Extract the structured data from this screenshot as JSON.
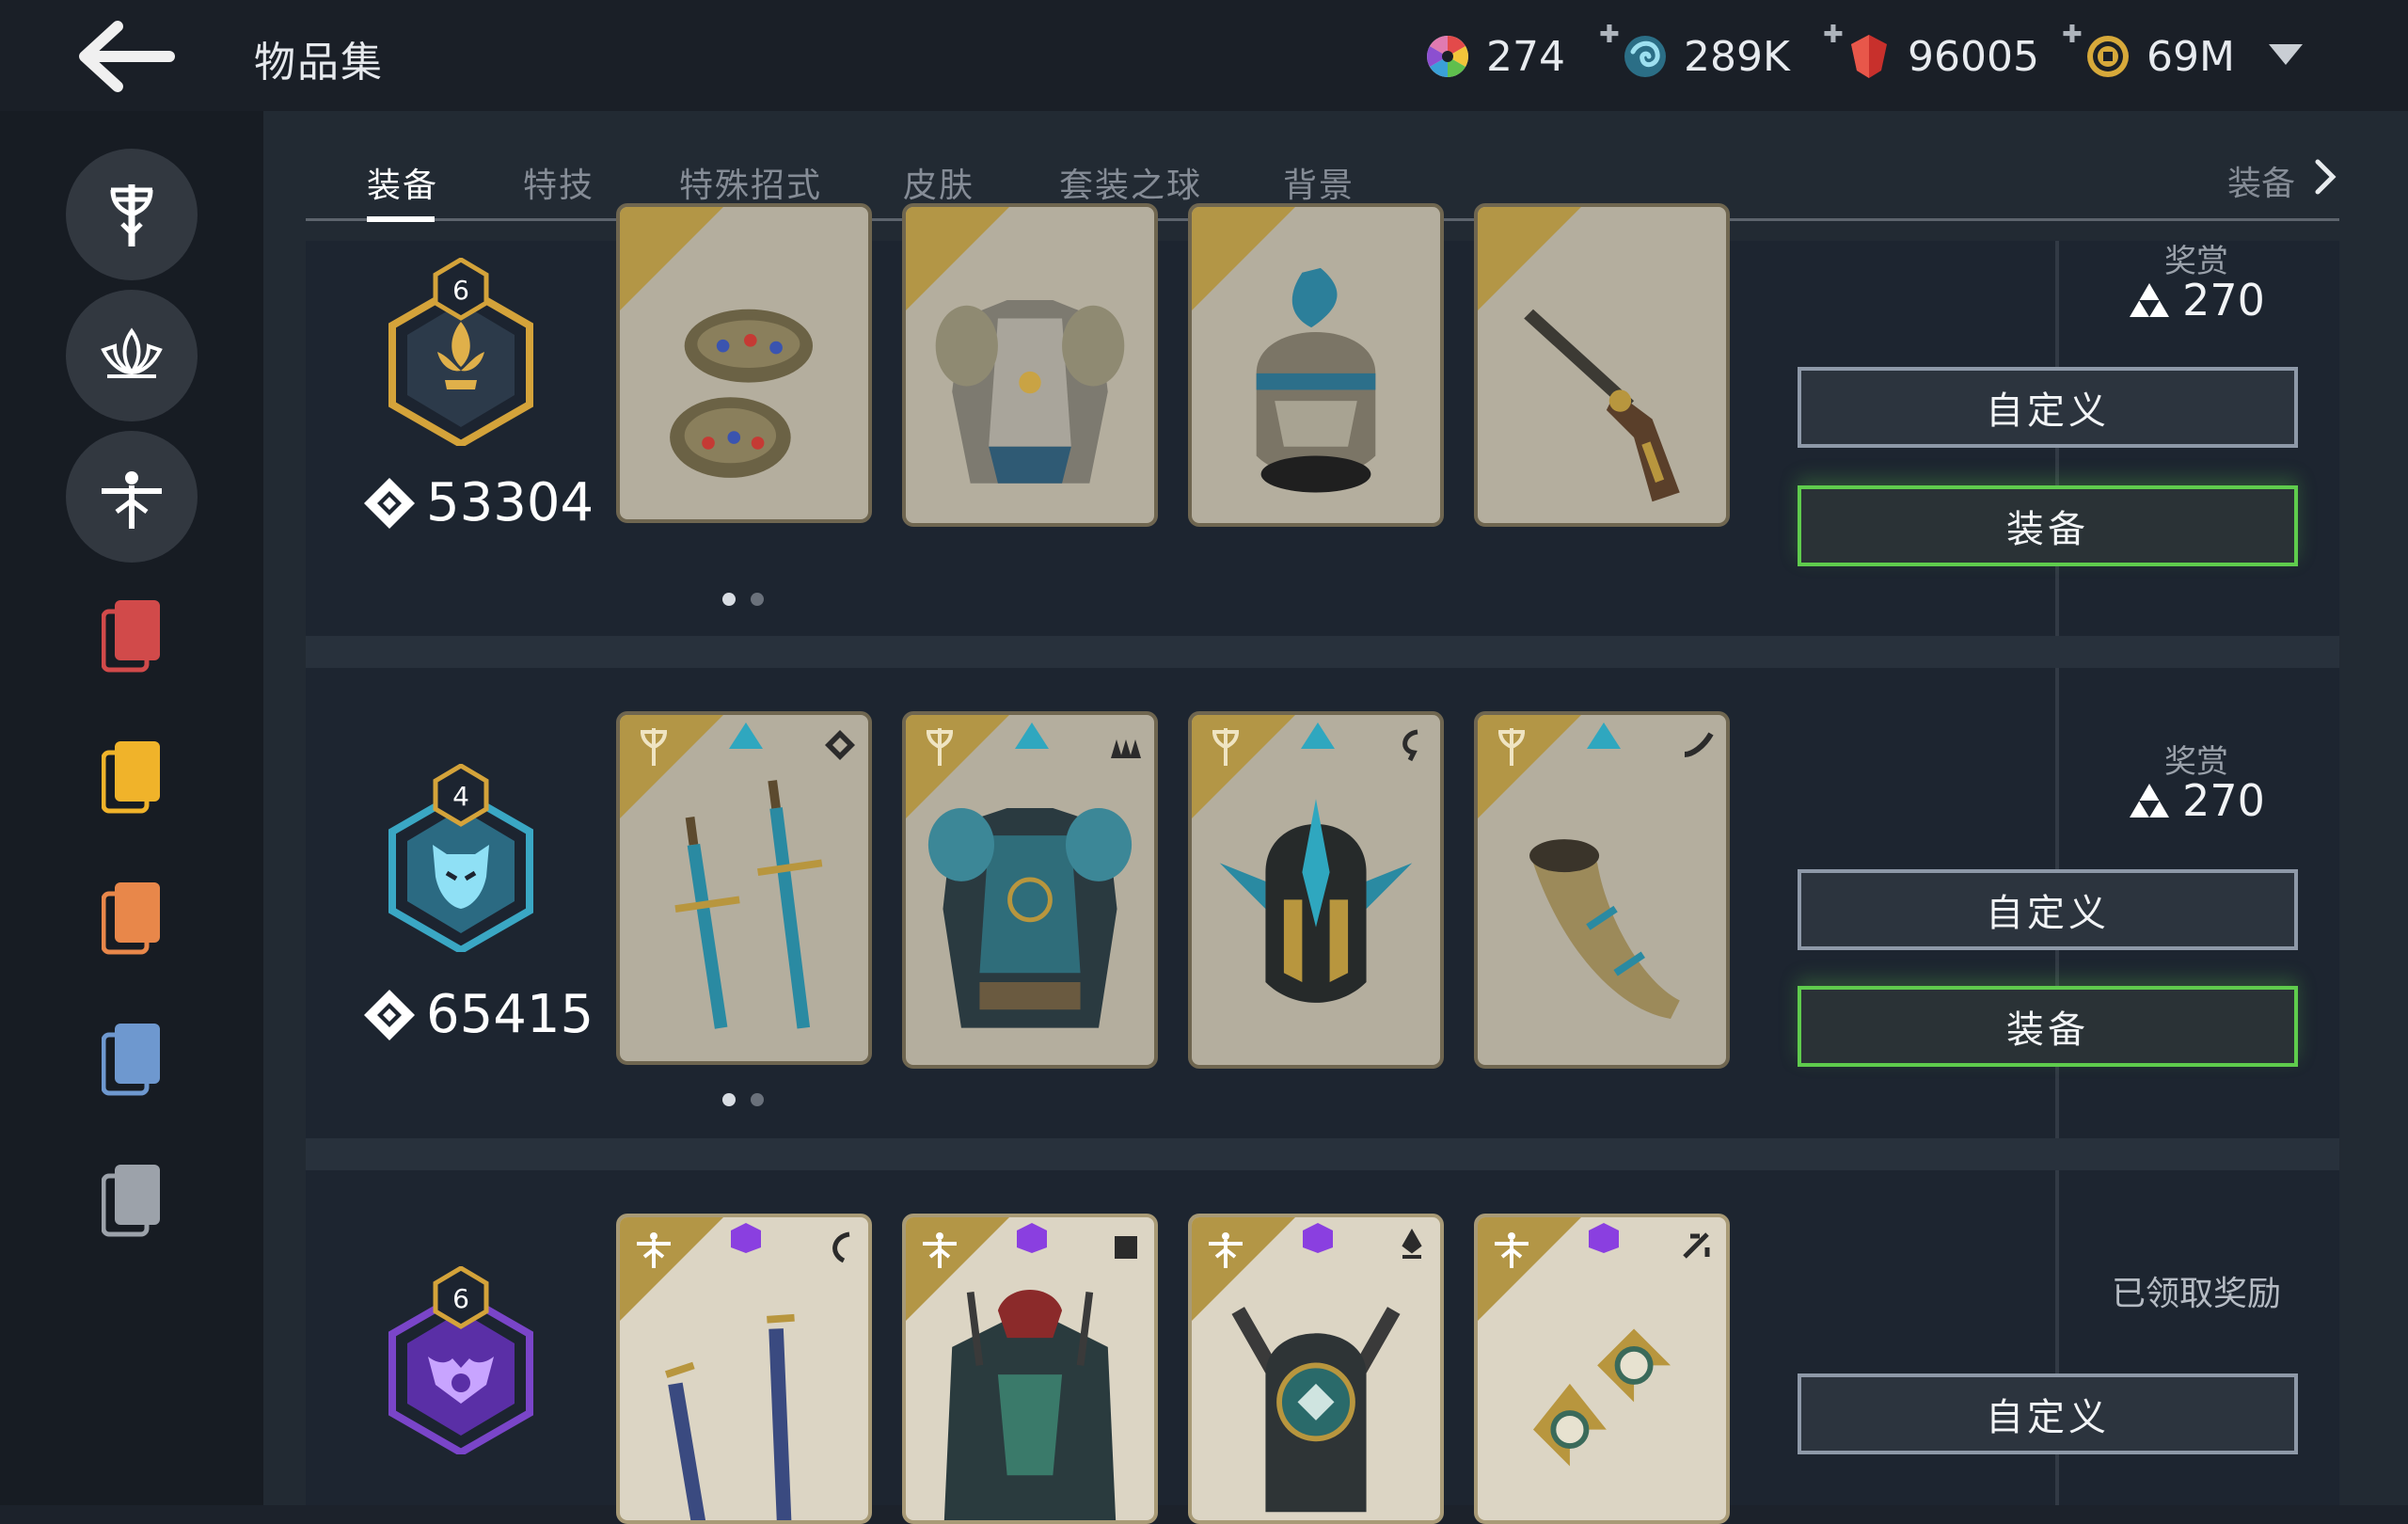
{
  "header": {
    "title": "物品集",
    "currencies": [
      {
        "icon": "color-wheel-icon",
        "value": "274",
        "has_plus": false
      },
      {
        "icon": "steel-swirl-icon",
        "value": "289K",
        "has_plus": true
      },
      {
        "icon": "red-crystal-icon",
        "value": "96005",
        "has_plus": true
      },
      {
        "icon": "gold-coin-icon",
        "value": "69M",
        "has_plus": true
      }
    ]
  },
  "sidebar": {
    "factions": [
      {
        "name": "knights-faction-icon"
      },
      {
        "name": "samurai-faction-icon"
      },
      {
        "name": "wu-lin-faction-icon"
      }
    ],
    "categories": [
      {
        "color": "#d14a4a"
      },
      {
        "color": "#f0b32a"
      },
      {
        "color": "#e8874a"
      },
      {
        "color": "#6e98cf"
      },
      {
        "color": "#9ca2aa"
      }
    ]
  },
  "tabs": {
    "items": [
      "装备",
      "特技",
      "特殊招式",
      "皮肤",
      "套装之球",
      "背景"
    ],
    "active_index": 0,
    "right_label": "装备"
  },
  "rows": [
    {
      "level": "6",
      "gear_score": "53304",
      "badge_color": "#d4a33a",
      "reward_title": "奖赏",
      "reward_value": "270",
      "custom_label": "自定义",
      "equip_label": "装备",
      "claimed_text": "",
      "card_names": [
        "gauntlets-item",
        "chest-armor-item",
        "helmet-item",
        "flintlock-item"
      ]
    },
    {
      "level": "4",
      "gear_score": "65415",
      "badge_color": "#3aa7c4",
      "reward_title": "奖赏",
      "reward_value": "270",
      "custom_label": "自定义",
      "equip_label": "装备",
      "claimed_text": "",
      "card_names": [
        "twin-swords-item",
        "chest-armor-item",
        "helmet-item",
        "war-horn-item"
      ]
    },
    {
      "level": "6",
      "gear_score": "",
      "badge_color": "#7a45c9",
      "reward_title": "",
      "reward_value": "",
      "custom_label": "自定义",
      "equip_label": "",
      "claimed_text": "已领取奖励",
      "card_names": [
        "dual-blades-item",
        "chest-armor-item",
        "helmet-item",
        "shuriken-item"
      ]
    }
  ]
}
